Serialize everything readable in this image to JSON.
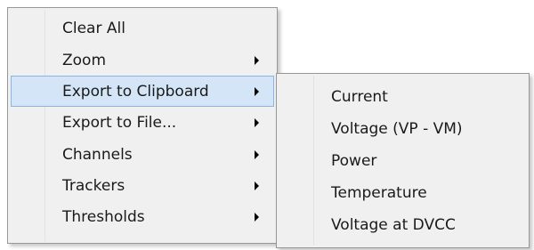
{
  "context_menu": {
    "items": [
      {
        "label": "Clear All",
        "has_submenu": false,
        "highlighted": false
      },
      {
        "label": "Zoom",
        "has_submenu": true,
        "highlighted": false
      },
      {
        "label": "Export to Clipboard",
        "has_submenu": true,
        "highlighted": true
      },
      {
        "label": "Export to File...",
        "has_submenu": true,
        "highlighted": false
      },
      {
        "label": "Channels",
        "has_submenu": true,
        "highlighted": false
      },
      {
        "label": "Trackers",
        "has_submenu": true,
        "highlighted": false
      },
      {
        "label": "Thresholds",
        "has_submenu": true,
        "highlighted": false
      }
    ]
  },
  "submenu": {
    "parent": "Export to Clipboard",
    "items": [
      {
        "label": "Current"
      },
      {
        "label": "Voltage (VP - VM)"
      },
      {
        "label": "Power"
      },
      {
        "label": "Temperature"
      },
      {
        "label": "Voltage at DVCC"
      }
    ]
  },
  "colors": {
    "menu_background": "#f0f0f0",
    "menu_border": "#979797",
    "highlight_background": "#d4e5f7",
    "highlight_border": "#89b4e3",
    "text": "#1a1a1a"
  },
  "icons": {
    "submenu_arrow": "submenu-arrow-icon"
  }
}
